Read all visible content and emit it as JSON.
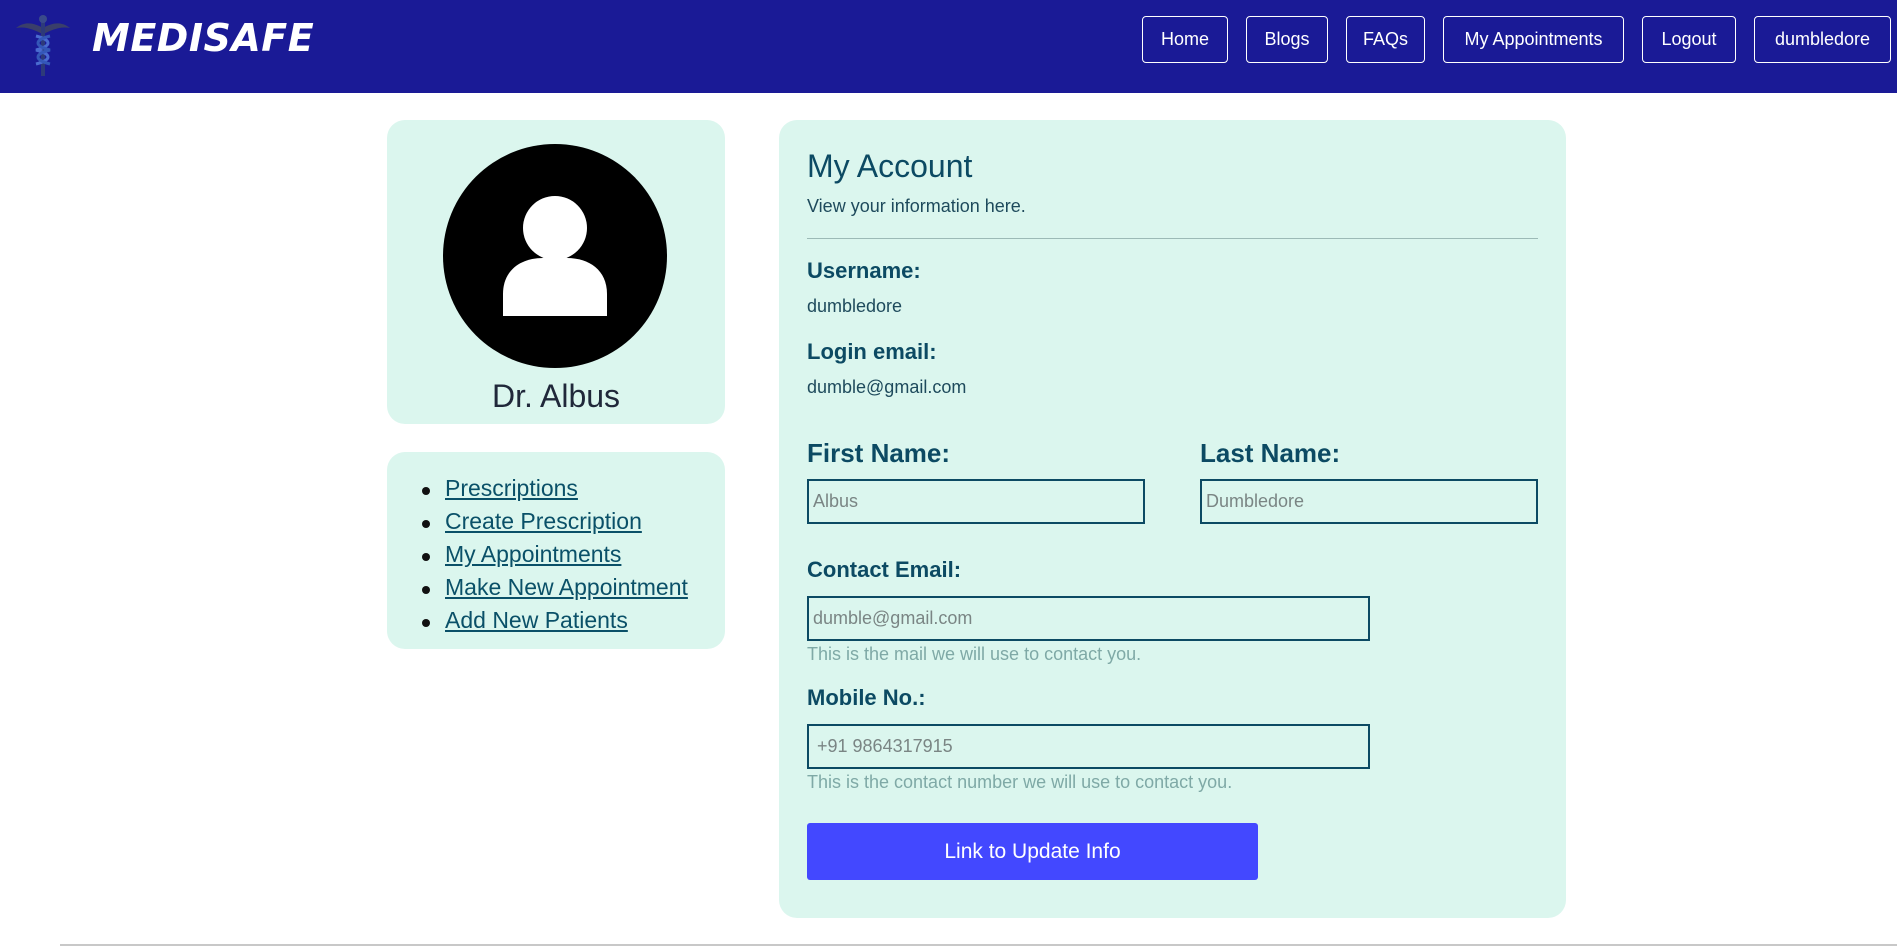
{
  "brand": {
    "name": "MEDISAFE",
    "logo_icon": "caduceus-icon"
  },
  "nav": [
    {
      "label": "Home"
    },
    {
      "label": "Blogs"
    },
    {
      "label": "FAQs"
    },
    {
      "label": "My Appointments"
    },
    {
      "label": "Logout"
    },
    {
      "label": "dumbledore"
    }
  ],
  "profile": {
    "avatar_icon": "user-avatar-icon",
    "name": "Dr. Albus"
  },
  "menu": [
    {
      "label": "Prescriptions"
    },
    {
      "label": "Create Prescription"
    },
    {
      "label": "My Appointments"
    },
    {
      "label": "Make New Appointment"
    },
    {
      "label": "Add New Patients"
    }
  ],
  "account": {
    "title": "My Account",
    "subtitle": "View your information here.",
    "username_label": "Username:",
    "username_value": "dumbledore",
    "login_email_label": "Login email:",
    "login_email_value": "dumble@gmail.com",
    "first_name_label": "First Name:",
    "first_name_placeholder": "Albus",
    "last_name_label": "Last Name:",
    "last_name_placeholder": "Dumbledore",
    "contact_email_label": "Contact Email:",
    "contact_email_placeholder": "dumble@gmail.com",
    "contact_email_hint": "This is the mail we will use to contact you.",
    "mobile_label": "Mobile No.:",
    "mobile_placeholder": "+91 9864317915",
    "mobile_hint": "This is the contact number we will use to contact you.",
    "update_button": "Link to Update Info"
  },
  "colors": {
    "navbar": "#1a1a96",
    "panel": "#dbf6ee",
    "accent_text": "#0c4a63",
    "button": "#4348ff"
  }
}
